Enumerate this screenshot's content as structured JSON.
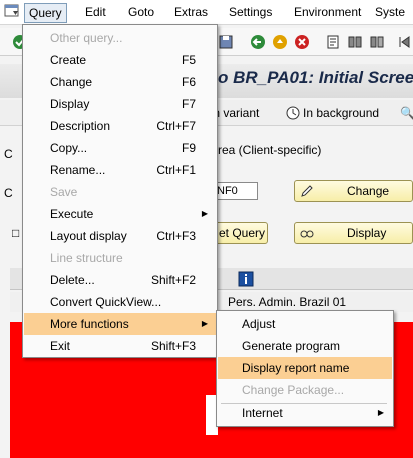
{
  "menubar": {
    "items": [
      "Query",
      "Edit",
      "Goto",
      "Extras",
      "Settings",
      "Environment",
      "Syste"
    ]
  },
  "title": "o BR_PA01: Initial Scree",
  "app_toolbar": {
    "with_variant": "th variant",
    "in_background": "In background"
  },
  "area_label": "rea (Client-specific)",
  "input_value": "NF0",
  "buttons": {
    "change": "Change",
    "display": "Display",
    "set_query": "et Query"
  },
  "grid": {
    "row_text": "Pers. Admin. Brazil 01"
  },
  "query_menu": {
    "items": [
      {
        "label": "Other query...",
        "shortcut": "",
        "disabled": true
      },
      {
        "label": "Create",
        "shortcut": "F5"
      },
      {
        "label": "Change",
        "shortcut": "F6"
      },
      {
        "label": "Display",
        "shortcut": "F7"
      },
      {
        "label": "Description",
        "shortcut": "Ctrl+F7"
      },
      {
        "label": "Copy...",
        "shortcut": "F9"
      },
      {
        "label": "Rename...",
        "shortcut": "Ctrl+F1"
      },
      {
        "label": "Save",
        "shortcut": "",
        "disabled": true
      },
      {
        "label": "Execute",
        "shortcut": ""
      },
      {
        "label": "Layout display",
        "shortcut": "Ctrl+F3"
      },
      {
        "label": "Line structure",
        "shortcut": "",
        "disabled": true
      },
      {
        "label": "Delete...",
        "shortcut": "Shift+F2"
      },
      {
        "label": "Convert QuickView...",
        "shortcut": ""
      },
      {
        "label": "More functions",
        "shortcut": ""
      },
      {
        "label": "Exit",
        "shortcut": "Shift+F3"
      }
    ]
  },
  "more_functions_submenu": {
    "items": [
      {
        "label": "Adjust"
      },
      {
        "label": "Generate program"
      },
      {
        "label": "Display report name"
      },
      {
        "label": "Change Package...",
        "disabled": true
      },
      {
        "label": "Internet"
      }
    ]
  },
  "colors": {
    "highlight": "#fbcf93",
    "button_yellow": "#f7eea8",
    "red_area": "#ff0000"
  }
}
